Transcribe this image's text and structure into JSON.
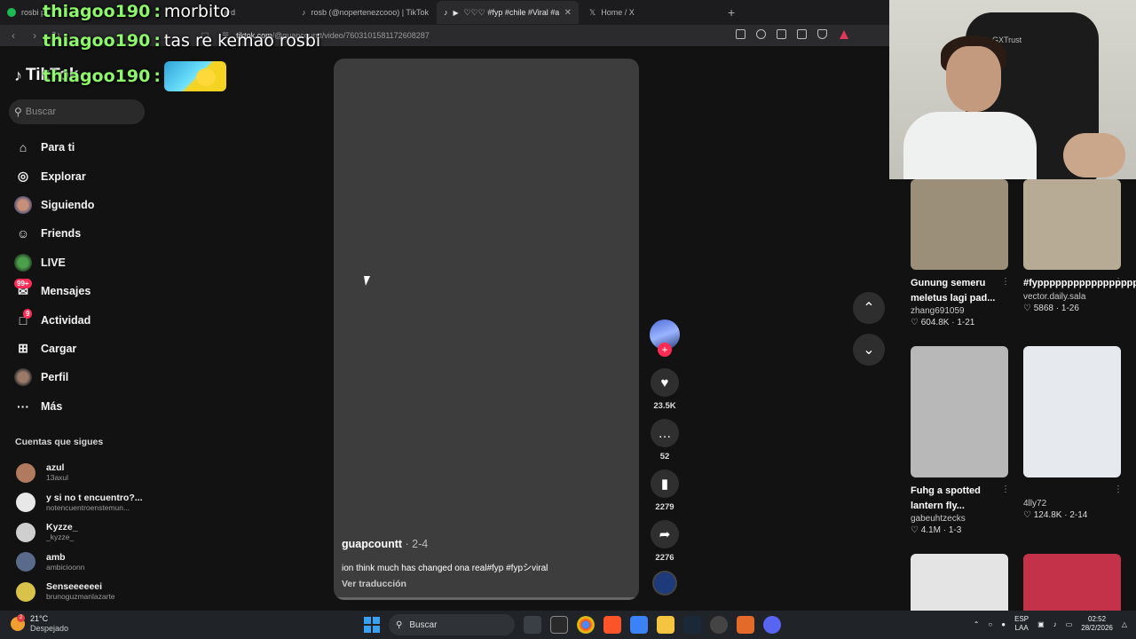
{
  "chat": [
    {
      "user": "thiagoo190",
      "sep": ":",
      "message": "morbito"
    },
    {
      "user": "thiagoo190",
      "sep": ":",
      "message": "tas re kemao rosbi"
    },
    {
      "user": "thiagoo190",
      "sep": ":",
      "message": ""
    }
  ],
  "browser": {
    "tabs": [
      {
        "title": "rosbi p",
        "icon_color": "#1db954",
        "active": false
      },
      {
        "title": "ard",
        "icon_color": "#888888",
        "active": false
      },
      {
        "title": "rosb (@nopertenezcooo) | TikTok",
        "icon_color": "#ffffff",
        "active": false
      },
      {
        "title": "♡♡♡ #fyp #chile #Viral #arte",
        "icon_color": "#ffffff",
        "active": true
      },
      {
        "title": "Home / X",
        "icon_color": "#ffffff",
        "active": false
      }
    ],
    "new_tab": "+",
    "url_host": "tiktok.com",
    "url_path": "/@guapcountt/video/7603101581172608287"
  },
  "sidebar": {
    "logo": "TikTok",
    "search_placeholder": "Buscar",
    "nav": [
      {
        "label": "Para ti",
        "icon": "home-icon",
        "glyph": "⌂"
      },
      {
        "label": "Explorar",
        "icon": "compass-icon",
        "glyph": "◎"
      },
      {
        "label": "Siguiendo",
        "icon": "following-avatar-icon",
        "glyph": ""
      },
      {
        "label": "Friends",
        "icon": "friends-icon",
        "glyph": "☺"
      },
      {
        "label": "LIVE",
        "icon": "live-icon",
        "glyph": ""
      },
      {
        "label": "Mensajes",
        "icon": "messages-icon",
        "glyph": "✉",
        "badge": "99+"
      },
      {
        "label": "Actividad",
        "icon": "activity-icon",
        "glyph": "□",
        "badge": "9"
      },
      {
        "label": "Cargar",
        "icon": "upload-icon",
        "glyph": "⊞"
      },
      {
        "label": "Perfil",
        "icon": "profile-avatar-icon",
        "glyph": ""
      },
      {
        "label": "Más",
        "icon": "more-icon",
        "glyph": "···"
      }
    ],
    "following_title": "Cuentas que sigues",
    "accounts": [
      {
        "name": "azul",
        "handle": "13axul",
        "color": "#b07a5e"
      },
      {
        "name": "y si no t encuentro?...",
        "handle": "notencuentroenstemun...",
        "color": "#e8e8e8"
      },
      {
        "name": "Kyzze_",
        "handle": "_kyzze_",
        "color": "#cfcfcf"
      },
      {
        "name": "amb",
        "handle": "ambicioonn",
        "color": "#5a6a8a"
      },
      {
        "name": "Senseeeeeei",
        "handle": "brunoguzmanlazarte",
        "color": "#d9c24a"
      }
    ]
  },
  "video": {
    "author": "guapcountt",
    "date": " · 2-4",
    "description": "ion think much has changed ona real#fyp #fypシviral",
    "translate": "Ver traducción",
    "likes": "23.5K",
    "comments": "52",
    "saves": "2279",
    "shares": "2276"
  },
  "webcam": {
    "chair_brand": "GXTrust"
  },
  "feed": [
    {
      "title": "Gunung semeru meletus lagi pad...",
      "user": "zhang691059",
      "likes": "604.8K",
      "date": "1-21",
      "thumb_color": "#9c8f7a"
    },
    {
      "title": "#fypppppppppppppppppppppp...",
      "user": "vector.daily.sala",
      "likes": "5868",
      "date": "1-26",
      "thumb_color": "#b7ab95"
    },
    {
      "title": "Fuhg a spotted lantern fly...",
      "user": "gabeuhtzecks",
      "likes": "4.1M",
      "date": "1-3",
      "thumb_color": "#b8b8b8"
    },
    {
      "title": "",
      "user": "4lly72",
      "likes": "124.8K",
      "date": "2-14",
      "thumb_color": "#e6e9ee"
    },
    {
      "title": "",
      "user": "",
      "likes": "",
      "date": "",
      "thumb_color": "#e4e4e4"
    },
    {
      "title": "",
      "user": "",
      "likes": "",
      "date": "",
      "thumb_color": "#c4324a"
    }
  ],
  "taskbar": {
    "temp": "21°C",
    "weather": "Despejado",
    "search": "Buscar",
    "lang_top": "ESP",
    "lang_bottom": "LAA",
    "time": "02:52",
    "date": "28/2/2026"
  }
}
